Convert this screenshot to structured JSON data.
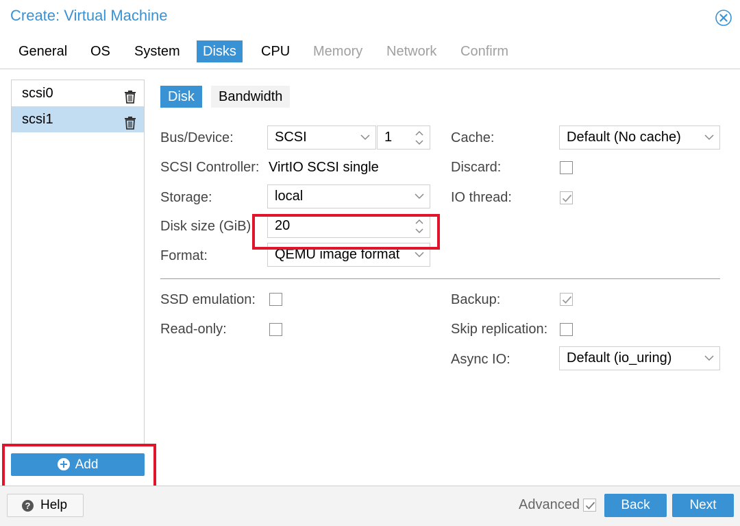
{
  "window": {
    "title": "Create: Virtual Machine",
    "close_icon": "close-circle-icon"
  },
  "tabs": [
    {
      "label": "General",
      "state": "enabled"
    },
    {
      "label": "OS",
      "state": "enabled"
    },
    {
      "label": "System",
      "state": "enabled"
    },
    {
      "label": "Disks",
      "state": "active"
    },
    {
      "label": "CPU",
      "state": "enabled"
    },
    {
      "label": "Memory",
      "state": "disabled"
    },
    {
      "label": "Network",
      "state": "disabled"
    },
    {
      "label": "Confirm",
      "state": "disabled"
    }
  ],
  "disk_list": {
    "items": [
      {
        "label": "scsi0",
        "selected": false
      },
      {
        "label": "scsi1",
        "selected": true
      }
    ],
    "add_label": "Add"
  },
  "subtabs": {
    "disk": "Disk",
    "bandwidth": "Bandwidth"
  },
  "form": {
    "bus_device": {
      "label": "Bus/Device:",
      "bus": "SCSI",
      "device": "1"
    },
    "scsi_controller": {
      "label": "SCSI Controller:",
      "value": "VirtIO SCSI single"
    },
    "storage": {
      "label": "Storage:",
      "value": "local"
    },
    "disk_size": {
      "label": "Disk size (GiB):",
      "value": "20"
    },
    "format": {
      "label": "Format:",
      "value": "QEMU image format"
    },
    "cache": {
      "label": "Cache:",
      "value": "Default (No cache)"
    },
    "discard": {
      "label": "Discard:",
      "checked": false
    },
    "io_thread": {
      "label": "IO thread:",
      "checked": true
    },
    "ssd_emulation": {
      "label": "SSD emulation:",
      "checked": false
    },
    "read_only": {
      "label": "Read-only:",
      "checked": false
    },
    "backup": {
      "label": "Backup:",
      "checked": true
    },
    "skip_replication": {
      "label": "Skip replication:",
      "checked": false
    },
    "async_io": {
      "label": "Async IO:",
      "value": "Default (io_uring)"
    }
  },
  "footer": {
    "help": "Help",
    "advanced": "Advanced",
    "advanced_checked": true,
    "back": "Back",
    "next": "Next"
  },
  "colors": {
    "accent": "#3892d4",
    "highlight": "#e0142a",
    "selected_row": "#c2ddf2"
  }
}
